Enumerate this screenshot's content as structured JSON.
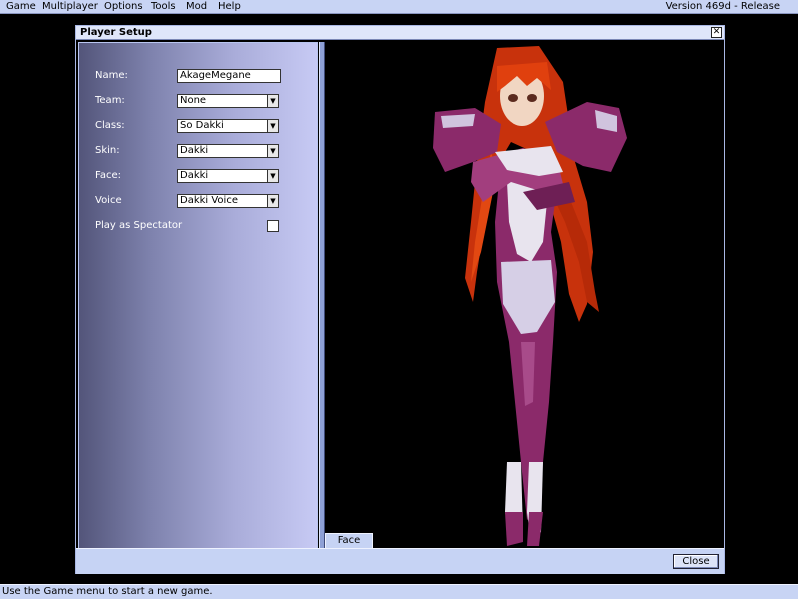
{
  "menubar": {
    "items": [
      {
        "label": "Game"
      },
      {
        "label": "Multiplayer"
      },
      {
        "label": "Options"
      },
      {
        "label": "Tools"
      },
      {
        "label": "Mod"
      },
      {
        "label": "Help"
      }
    ],
    "version": "Version 469d - Release"
  },
  "window": {
    "title": "Player Setup",
    "close_glyph": "✕",
    "form": {
      "name_label": "Name:",
      "name_value": "AkageMegane",
      "team_label": "Team:",
      "team_value": "None",
      "class_label": "Class:",
      "class_value": "So Dakki",
      "skin_label": "Skin:",
      "skin_value": "Dakki",
      "face_label": "Face:",
      "face_value": "Dakki",
      "voice_label": "Voice",
      "voice_value": "Dakki Voice",
      "spectator_label": "Play as Spectator",
      "spectator_checked": false
    },
    "preview": {
      "face_tab_label": "Face"
    },
    "close_button_label": "Close"
  },
  "status": {
    "text": "Use the Game menu to start a new game."
  },
  "colors": {
    "hair": "#d8340e",
    "suit": "#8b2a6a",
    "white": "#e8e4ee"
  }
}
